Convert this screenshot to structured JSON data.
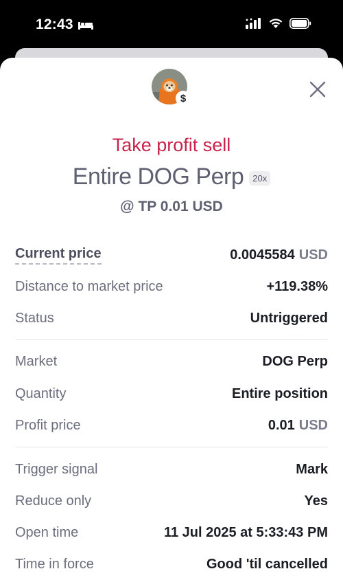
{
  "status_bar": {
    "time": "12:43"
  },
  "header": {
    "order_type": "Take profit sell",
    "title": "Entire DOG Perp",
    "leverage": "20x",
    "trigger": "@ TP 0.01 USD",
    "badge_symbol": "$"
  },
  "rows": [
    {
      "label": "Current price",
      "value": "0.0045584",
      "unit": "USD"
    },
    {
      "label": "Distance to market price",
      "value": "+119.38%"
    },
    {
      "label": "Status",
      "value": "Untriggered"
    },
    {
      "label": "Market",
      "value": "DOG Perp"
    },
    {
      "label": "Quantity",
      "value": "Entire position"
    },
    {
      "label": "Profit price",
      "value": "0.01",
      "unit": "USD"
    },
    {
      "label": "Trigger signal",
      "value": "Mark"
    },
    {
      "label": "Reduce only",
      "value": "Yes"
    },
    {
      "label": "Open time",
      "value": "11 Jul 2025 at 5:33:43 PM"
    },
    {
      "label": "Time in force",
      "value": "Good 'til cancelled"
    }
  ],
  "colors": {
    "accent_sell": "#c9234b",
    "title_gray": "#5e6072"
  }
}
